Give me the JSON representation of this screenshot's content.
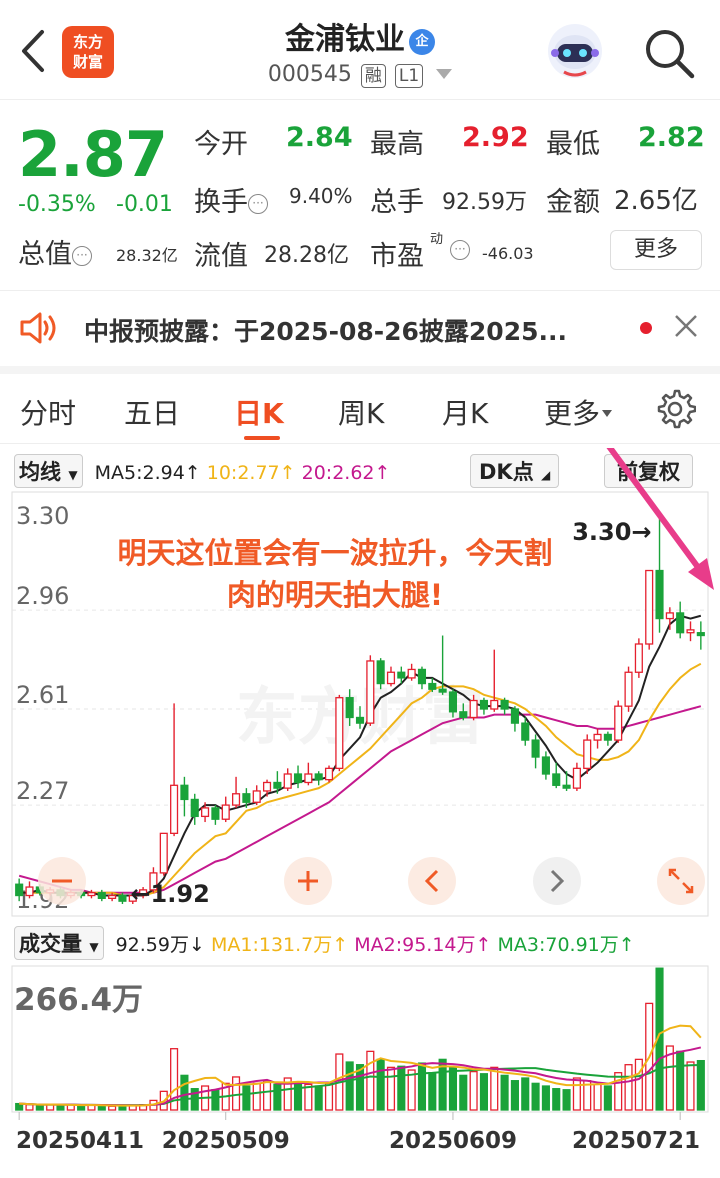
{
  "header": {
    "logo_line1": "东方",
    "logo_line2": "财富",
    "stock_name": "金浦钛业",
    "name_badge": "企",
    "stock_code": "000545",
    "margin_tag": "融",
    "level_tag": "L1"
  },
  "quote": {
    "price": "2.87",
    "change_pct": "-0.35%",
    "change_amt": "-0.01",
    "open_label": "今开",
    "open_value": "2.84",
    "high_label": "最高",
    "high_value": "2.92",
    "low_label": "最低",
    "low_value": "2.82",
    "turnover_label": "换手",
    "turnover_value": "9.40%",
    "volume_label": "总手",
    "volume_value": "92.59万",
    "amount_label": "金额",
    "amount_value": "2.65亿",
    "mktcap_label": "总值",
    "mktcap_value": "28.32亿",
    "float_label": "流值",
    "float_value": "28.28亿",
    "pe_label": "市盈",
    "pe_sup": "动",
    "pe_value": "-46.03",
    "more_label": "更多",
    "colors": {
      "up": "#e5202e",
      "down": "#1aa33a"
    }
  },
  "notice": {
    "text": "中报预披露：于2025-08-26披露2025..."
  },
  "tabs": [
    {
      "label": "分时"
    },
    {
      "label": "五日"
    },
    {
      "label": "日K"
    },
    {
      "label": "周K"
    },
    {
      "label": "月K"
    },
    {
      "label": "更多"
    }
  ],
  "active_tab": "日K",
  "kline_toolbar": {
    "ma_select": "均线",
    "ma5": "MA5:2.94↑",
    "ma10": "10:2.77↑",
    "ma20": "20:2.62↑",
    "dk_label": "DK点",
    "adjust_label": "前复权"
  },
  "annotation": {
    "line1": "明天这位置会有一波拉升，今天割",
    "line2": "肉的明天拍大腿!"
  },
  "chart_data": {
    "type": "candlestick",
    "y_ticks": [
      "3.30",
      "2.96",
      "2.61",
      "2.27",
      "1.92"
    ],
    "ylim": [
      1.92,
      3.3
    ],
    "max_marker": "3.30",
    "min_marker": "1.92",
    "watermark": "东方财富",
    "candles": [
      [
        1.99,
        1.95,
        2.01,
        1.93
      ],
      [
        1.95,
        1.98,
        2.0,
        1.94
      ],
      [
        1.98,
        1.96,
        1.99,
        1.95
      ],
      [
        1.96,
        1.97,
        1.98,
        1.95
      ],
      [
        1.97,
        1.95,
        1.98,
        1.94
      ],
      [
        1.95,
        1.96,
        1.97,
        1.94
      ],
      [
        1.96,
        1.95,
        1.97,
        1.94
      ],
      [
        1.95,
        1.96,
        1.97,
        1.94
      ],
      [
        1.96,
        1.94,
        1.97,
        1.93
      ],
      [
        1.94,
        1.95,
        1.96,
        1.93
      ],
      [
        1.95,
        1.93,
        1.96,
        1.92
      ],
      [
        1.93,
        1.95,
        1.96,
        1.92
      ],
      [
        1.95,
        1.97,
        1.98,
        1.94
      ],
      [
        1.97,
        2.03,
        2.05,
        1.96
      ],
      [
        2.03,
        2.17,
        2.17,
        2.02
      ],
      [
        2.17,
        2.34,
        2.63,
        2.16
      ],
      [
        2.34,
        2.29,
        2.37,
        2.23
      ],
      [
        2.29,
        2.23,
        2.31,
        2.2
      ],
      [
        2.23,
        2.26,
        2.28,
        2.21
      ],
      [
        2.26,
        2.22,
        2.27,
        2.2
      ],
      [
        2.22,
        2.27,
        2.3,
        2.21
      ],
      [
        2.27,
        2.31,
        2.37,
        2.26
      ],
      [
        2.31,
        2.28,
        2.33,
        2.26
      ],
      [
        2.28,
        2.32,
        2.34,
        2.27
      ],
      [
        2.32,
        2.35,
        2.36,
        2.3
      ],
      [
        2.35,
        2.33,
        2.39,
        2.31
      ],
      [
        2.33,
        2.38,
        2.4,
        2.32
      ],
      [
        2.38,
        2.35,
        2.41,
        2.33
      ],
      [
        2.35,
        2.38,
        2.42,
        2.34
      ],
      [
        2.38,
        2.36,
        2.39,
        2.34
      ],
      [
        2.36,
        2.4,
        2.41,
        2.35
      ],
      [
        2.4,
        2.65,
        2.66,
        2.39
      ],
      [
        2.65,
        2.58,
        2.68,
        2.55
      ],
      [
        2.58,
        2.56,
        2.62,
        2.54
      ],
      [
        2.56,
        2.78,
        2.8,
        2.55
      ],
      [
        2.78,
        2.7,
        2.79,
        2.68
      ],
      [
        2.7,
        2.74,
        2.76,
        2.69
      ],
      [
        2.74,
        2.72,
        2.76,
        2.7
      ],
      [
        2.72,
        2.75,
        2.77,
        2.71
      ],
      [
        2.75,
        2.7,
        2.76,
        2.68
      ],
      [
        2.7,
        2.68,
        2.72,
        2.67
      ],
      [
        2.68,
        2.67,
        2.87,
        2.66
      ],
      [
        2.67,
        2.6,
        2.68,
        2.58
      ],
      [
        2.6,
        2.58,
        2.63,
        2.57
      ],
      [
        2.58,
        2.64,
        2.66,
        2.57
      ],
      [
        2.64,
        2.61,
        2.65,
        2.59
      ],
      [
        2.61,
        2.64,
        2.82,
        2.6
      ],
      [
        2.64,
        2.61,
        2.65,
        2.59
      ],
      [
        2.61,
        2.56,
        2.62,
        2.53
      ],
      [
        2.56,
        2.5,
        2.58,
        2.48
      ],
      [
        2.5,
        2.44,
        2.52,
        2.4
      ],
      [
        2.44,
        2.38,
        2.46,
        2.36
      ],
      [
        2.38,
        2.34,
        2.42,
        2.33
      ],
      [
        2.34,
        2.33,
        2.39,
        2.32
      ],
      [
        2.33,
        2.4,
        2.42,
        2.32
      ],
      [
        2.4,
        2.5,
        2.52,
        2.38
      ],
      [
        2.5,
        2.52,
        2.54,
        2.47
      ],
      [
        2.52,
        2.5,
        2.53,
        2.48
      ],
      [
        2.5,
        2.62,
        2.64,
        2.49
      ],
      [
        2.62,
        2.74,
        2.76,
        2.6
      ],
      [
        2.74,
        2.84,
        2.86,
        2.72
      ],
      [
        2.84,
        3.1,
        3.1,
        2.82
      ],
      [
        3.1,
        2.93,
        3.3,
        2.88
      ],
      [
        2.93,
        2.95,
        2.97,
        2.89
      ],
      [
        2.95,
        2.88,
        2.99,
        2.86
      ],
      [
        2.88,
        2.89,
        2.92,
        2.85
      ],
      [
        2.88,
        2.87,
        2.92,
        2.82
      ]
    ],
    "ma5": [
      1.96,
      1.96,
      1.97,
      1.96,
      1.96,
      1.96,
      1.96,
      1.96,
      1.95,
      1.95,
      1.95,
      1.95,
      1.95,
      1.97,
      2.01,
      2.09,
      2.17,
      2.24,
      2.27,
      2.27,
      2.25,
      2.26,
      2.27,
      2.28,
      2.31,
      2.32,
      2.34,
      2.35,
      2.36,
      2.36,
      2.37,
      2.43,
      2.47,
      2.51,
      2.59,
      2.65,
      2.67,
      2.7,
      2.74,
      2.72,
      2.72,
      2.7,
      2.68,
      2.66,
      2.63,
      2.62,
      2.62,
      2.62,
      2.61,
      2.58,
      2.53,
      2.48,
      2.42,
      2.38,
      2.36,
      2.39,
      2.42,
      2.46,
      2.5,
      2.57,
      2.64,
      2.76,
      2.83,
      2.91,
      2.94,
      2.93,
      2.94
    ],
    "ma10": [
      1.96,
      1.96,
      1.96,
      1.96,
      1.96,
      1.96,
      1.96,
      1.96,
      1.96,
      1.96,
      1.95,
      1.95,
      1.95,
      1.96,
      1.98,
      2.02,
      2.06,
      2.1,
      2.13,
      2.16,
      2.17,
      2.21,
      2.25,
      2.26,
      2.28,
      2.29,
      2.3,
      2.31,
      2.32,
      2.33,
      2.35,
      2.38,
      2.41,
      2.44,
      2.47,
      2.51,
      2.55,
      2.59,
      2.63,
      2.65,
      2.68,
      2.69,
      2.69,
      2.69,
      2.68,
      2.66,
      2.65,
      2.64,
      2.63,
      2.61,
      2.58,
      2.55,
      2.51,
      2.48,
      2.45,
      2.44,
      2.43,
      2.43,
      2.44,
      2.46,
      2.5,
      2.57,
      2.63,
      2.68,
      2.72,
      2.75,
      2.77
    ],
    "ma20": [
      2.02,
      2.01,
      2.0,
      1.99,
      1.98,
      1.97,
      1.97,
      1.96,
      1.96,
      1.96,
      1.96,
      1.96,
      1.96,
      1.96,
      1.97,
      1.99,
      2.01,
      2.03,
      2.05,
      2.07,
      2.08,
      2.1,
      2.12,
      2.14,
      2.16,
      2.18,
      2.2,
      2.22,
      2.24,
      2.26,
      2.28,
      2.31,
      2.34,
      2.37,
      2.4,
      2.43,
      2.46,
      2.48,
      2.5,
      2.52,
      2.54,
      2.56,
      2.57,
      2.58,
      2.58,
      2.58,
      2.59,
      2.59,
      2.59,
      2.59,
      2.59,
      2.58,
      2.57,
      2.56,
      2.55,
      2.55,
      2.54,
      2.54,
      2.54,
      2.55,
      2.56,
      2.57,
      2.58,
      2.59,
      2.6,
      2.61,
      2.62
    ],
    "volume_toolbar": {
      "select": "成交量",
      "vol": "92.59万↓",
      "ma1": "MA1:131.7万↑",
      "ma2": "MA2:95.14万↑",
      "ma3": "MA3:70.91万↑"
    },
    "volume_max_label": "266.4万",
    "volume_ylim": [
      0,
      266.4
    ],
    "volumes": [
      12,
      10,
      8,
      11,
      9,
      10,
      8,
      9,
      8,
      7,
      9,
      8,
      10,
      18,
      35,
      115,
      65,
      40,
      45,
      38,
      50,
      62,
      45,
      50,
      55,
      48,
      60,
      52,
      48,
      45,
      50,
      105,
      90,
      85,
      110,
      95,
      80,
      82,
      75,
      88,
      70,
      95,
      80,
      65,
      72,
      68,
      80,
      65,
      55,
      60,
      50,
      45,
      40,
      38,
      60,
      55,
      48,
      45,
      70,
      85,
      95,
      200,
      266,
      120,
      110,
      90,
      92.59
    ],
    "dates": [
      "20250411",
      "20250509",
      "20250609",
      "20250721"
    ],
    "date_indices": [
      0,
      20,
      42,
      64
    ]
  }
}
